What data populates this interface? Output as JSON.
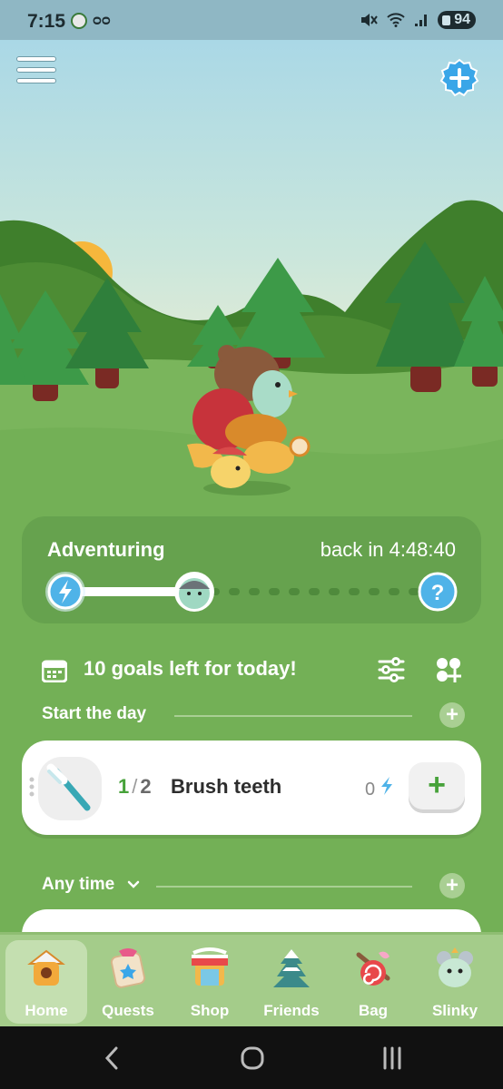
{
  "status_bar": {
    "time": "7:15",
    "battery": "94"
  },
  "adventure": {
    "title": "Adventuring",
    "return_text": "back in 4:48:40"
  },
  "goals": {
    "summary": "10 goals left for today!"
  },
  "sections": [
    {
      "label": "Start the day"
    },
    {
      "label": "Any time"
    }
  ],
  "task": {
    "done": "1",
    "total": "2",
    "name": "Brush teeth",
    "energy": "0"
  },
  "tabs": [
    {
      "label": "Home",
      "icon": "birdhouse-icon",
      "active": true
    },
    {
      "label": "Quests",
      "icon": "quest-card-icon"
    },
    {
      "label": "Shop",
      "icon": "shop-icon"
    },
    {
      "label": "Friends",
      "icon": "snowy-tree-icon"
    },
    {
      "label": "Bag",
      "icon": "candy-bag-icon"
    },
    {
      "label": "Slinky",
      "icon": "pet-avatar-icon"
    }
  ],
  "colors": {
    "accent_green": "#47a23a",
    "energy_blue": "#4fb3e8",
    "panel_green": "#66a24e"
  }
}
